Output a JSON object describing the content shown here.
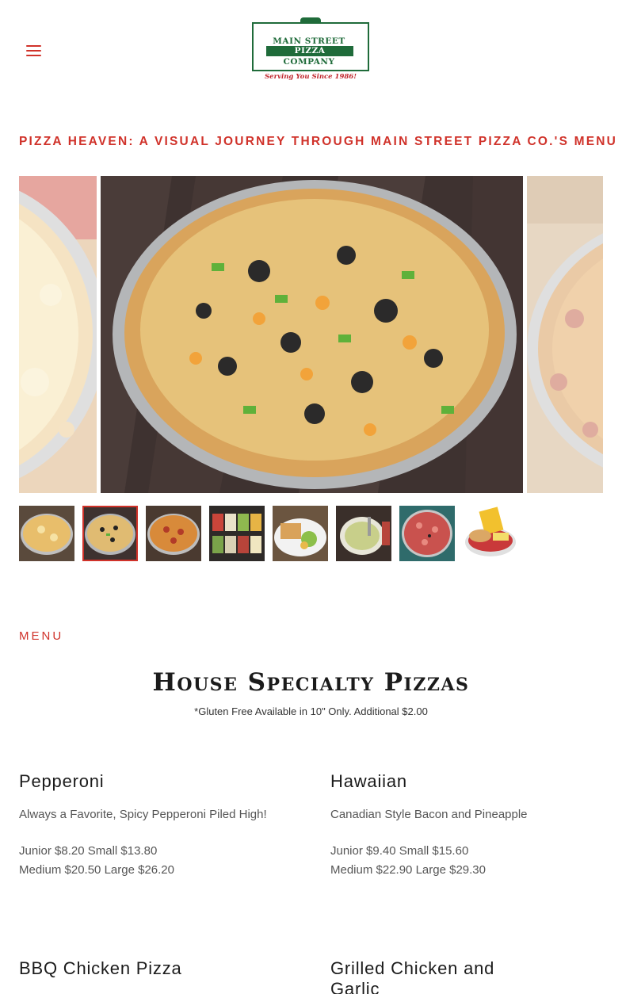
{
  "header": {
    "menu_icon": "hamburger-menu-icon",
    "logo": {
      "line1": "MAIN STREET",
      "line2": "PIZZA",
      "line3": "COMPANY",
      "tagline": "Serving You Since 1986!"
    }
  },
  "gallery": {
    "title": "PIZZA HEAVEN: A VISUAL JOURNEY THROUGH MAIN STREET PIZZA CO.'S MENU",
    "active_index": 1,
    "thumbnails": [
      "cheese pizza",
      "supreme pizza",
      "pepperoni pizza",
      "salad bar",
      "sandwich with salad",
      "soup",
      "pizza with tomatoes",
      "sandwich basket with chips"
    ]
  },
  "menu": {
    "section_label": "MENU",
    "heading": "House Specialty Pizzas",
    "note": "*Gluten Free Available in 10\" Only. Additional $2.00",
    "items": [
      {
        "name": "Pepperoni",
        "description": "Always a Favorite, Spicy Pepperoni Piled High!",
        "price_line1": "Junior $8.20 Small $13.80",
        "price_line2": "Medium $20.50 Large $26.20"
      },
      {
        "name": "Hawaiian",
        "description": "Canadian Style Bacon and Pineapple",
        "price_line1": "Junior $9.40 Small $15.60",
        "price_line2": "Medium $22.90 Large $29.30"
      },
      {
        "name": "BBQ Chicken Pizza",
        "description": "",
        "price_line1": "",
        "price_line2": ""
      },
      {
        "name": "Grilled Chicken and Garlic",
        "description": "",
        "price_line1": "",
        "price_line2": ""
      }
    ]
  },
  "colors": {
    "accent": "#d0322a",
    "logo_green": "#1f6b3a",
    "text": "#1b1b1b",
    "muted": "#555555"
  }
}
